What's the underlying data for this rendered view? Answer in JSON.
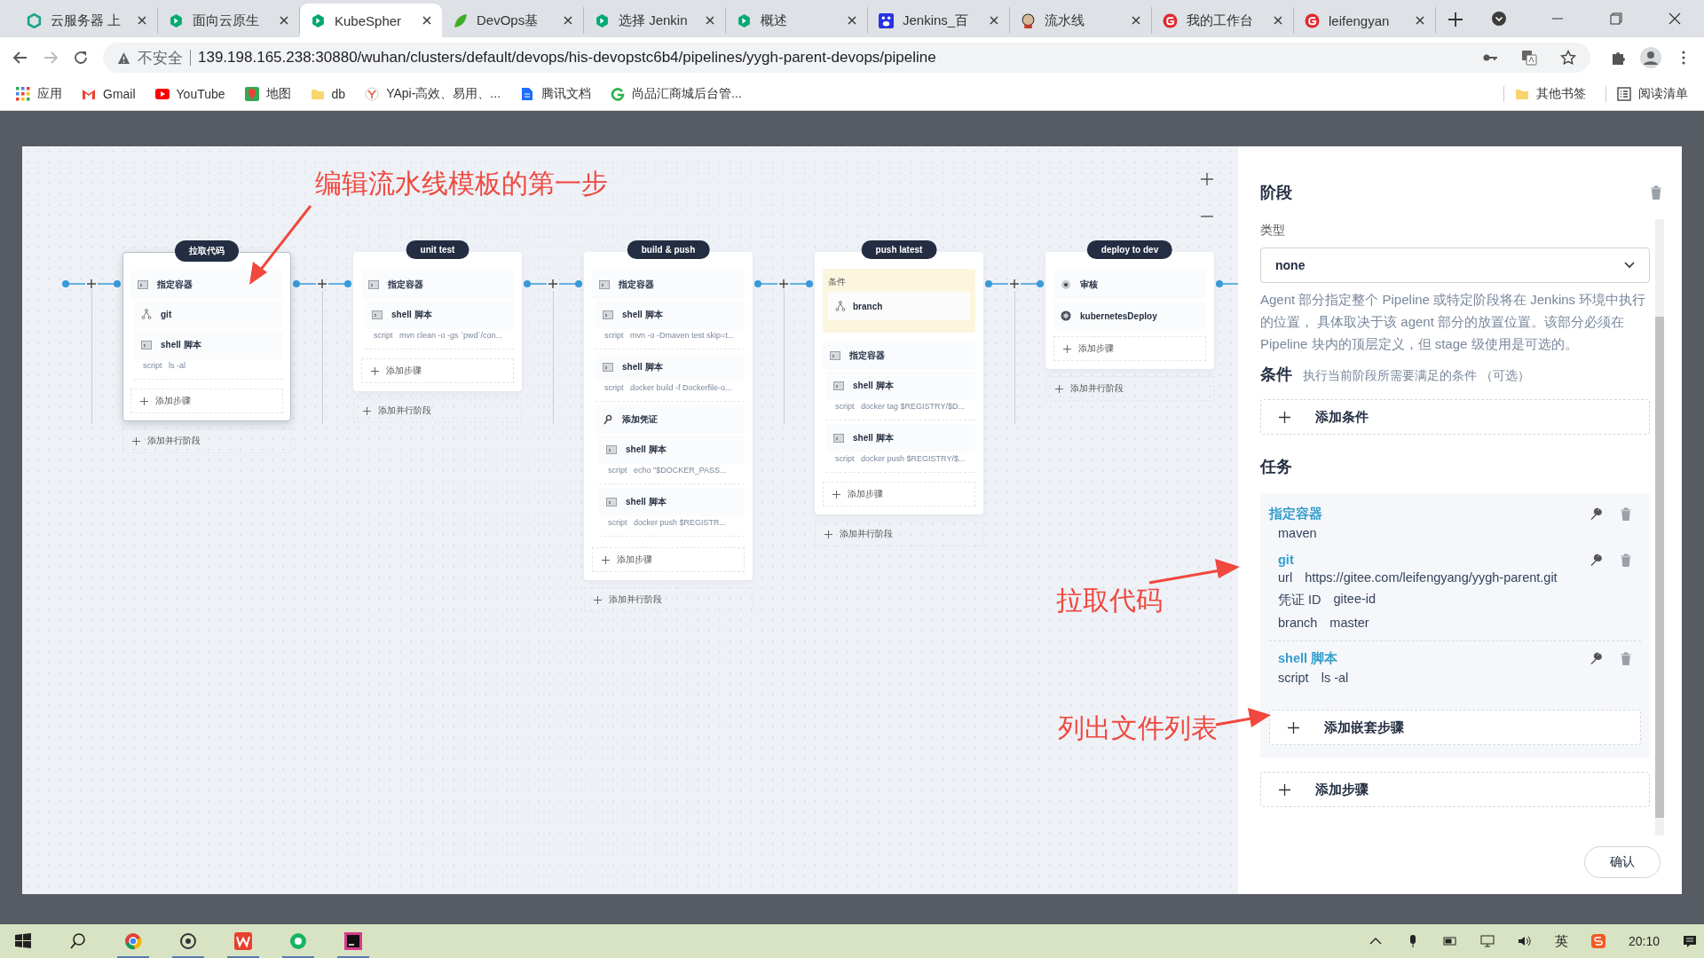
{
  "browser": {
    "tabs": [
      {
        "kind": "cloud",
        "title": "云服务器 上",
        "selected": false
      },
      {
        "kind": "kubesphere",
        "title": "面向云原生",
        "selected": false
      },
      {
        "kind": "kubesphere",
        "title": "KubeSpher",
        "selected": true
      },
      {
        "kind": "devops",
        "title": "DevOps基",
        "selected": false
      },
      {
        "kind": "kubesphere",
        "title": "选择 Jenkin",
        "selected": false
      },
      {
        "kind": "kubesphere",
        "title": "概述",
        "selected": false
      },
      {
        "kind": "baidu",
        "title": "Jenkins_百",
        "selected": false
      },
      {
        "kind": "jenkins",
        "title": "流水线",
        "selected": false
      },
      {
        "kind": "gitee",
        "title": "我的工作台",
        "selected": false
      },
      {
        "kind": "gitee",
        "title": "leifengyan",
        "selected": false
      }
    ],
    "security": "不安全",
    "url": "139.198.165.238:30880/wuhan/clusters/default/devops/his-devopstc6b4/pipelines/yygh-parent-devops/pipeline",
    "bookmarks": [
      {
        "kind": "apps",
        "label": "应用"
      },
      {
        "kind": "gmail",
        "label": "Gmail"
      },
      {
        "kind": "youtube",
        "label": "YouTube"
      },
      {
        "kind": "maps",
        "label": "地图"
      },
      {
        "kind": "folder",
        "label": "db"
      },
      {
        "kind": "yapi",
        "label": "YApi-高效、易用、..."
      },
      {
        "kind": "docs",
        "label": "腾讯文档"
      },
      {
        "kind": "g",
        "label": "尚品汇商城后台管..."
      }
    ],
    "other_bookmarks": "其他书签",
    "reading_list": "阅读清单"
  },
  "stages": [
    {
      "title": "拉取代码",
      "selected": true,
      "steps": [
        {
          "kind": "container",
          "name": "指定容器",
          "children": [
            {
              "kind": "git",
              "name": "git"
            },
            {
              "kind": "shell",
              "name": "shell 脚本",
              "detail_key": "script",
              "detail": "ls -al"
            }
          ]
        }
      ],
      "add_step": "添加步骤",
      "add_parallel": "添加并行阶段"
    },
    {
      "title": "unit test",
      "selected": false,
      "steps": [
        {
          "kind": "container",
          "name": "指定容器",
          "children": [
            {
              "kind": "shell",
              "name": "shell 脚本",
              "detail_key": "script",
              "detail": "mvn clean -o -gs `pwd`/con..."
            }
          ]
        }
      ],
      "add_step": "添加步骤",
      "add_parallel": "添加并行阶段"
    },
    {
      "title": "build & push",
      "selected": false,
      "steps": [
        {
          "kind": "container",
          "name": "指定容器",
          "children": [
            {
              "kind": "shell",
              "name": "shell 脚本",
              "detail_key": "script",
              "detail": "mvn -o -Dmaven test skip=t..."
            },
            {
              "kind": "shell",
              "name": "shell 脚本",
              "detail_key": "script",
              "detail": "docker build -f Dockerfile-o..."
            },
            {
              "kind": "credential",
              "name": "添加凭证",
              "children": [
                {
                  "kind": "shell",
                  "name": "shell 脚本",
                  "detail_key": "script",
                  "detail": "echo \"$DOCKER_PASS..."
                },
                {
                  "kind": "shell",
                  "name": "shell 脚本",
                  "detail_key": "script",
                  "detail": "docker push $REGISTR..."
                }
              ]
            }
          ]
        }
      ],
      "add_step": "添加步骤",
      "add_parallel": "添加并行阶段"
    },
    {
      "title": "push latest",
      "selected": false,
      "condition": {
        "label": "条件",
        "name": "branch"
      },
      "steps": [
        {
          "kind": "container",
          "name": "指定容器",
          "children": [
            {
              "kind": "shell",
              "name": "shell 脚本",
              "detail_key": "script",
              "detail": "docker tag $REGISTRY/$D..."
            },
            {
              "kind": "shell",
              "name": "shell 脚本",
              "detail_key": "script",
              "detail": "docker push $REGISTRY/$..."
            }
          ]
        }
      ],
      "add_step": "添加步骤",
      "add_parallel": "添加并行阶段"
    },
    {
      "title": "deploy to dev",
      "selected": false,
      "steps": [
        {
          "kind": "input",
          "name": "审核"
        },
        {
          "kind": "deploy",
          "name": "kubernetesDeploy"
        }
      ],
      "add_step": "添加步骤",
      "add_parallel": "添加并行阶段"
    }
  ],
  "panel": {
    "title": "阶段",
    "type_label": "类型",
    "type_value": "none",
    "description": "Agent 部分指定整个 Pipeline 或特定阶段将在 Jenkins 环境中执行的位置， 具体取决于该 agent 部分的放置位置。该部分必须在 Pipeline 块内的顶层定义，但 stage 级使用是可选的。",
    "conditions_title": "条件",
    "conditions_hint": "执行当前阶段所需要满足的条件 （可选）",
    "add_condition": "添加条件",
    "tasks_title": "任务",
    "tasks": [
      {
        "kind": "container",
        "name": "指定容器",
        "params": [
          {
            "value": "maven"
          }
        ],
        "children": [
          {
            "name": "git",
            "params": [
              {
                "key": "url",
                "value": "https://gitee.com/leifengyang/yygh-parent.git"
              },
              {
                "key": "凭证 ID",
                "value": "gitee-id"
              },
              {
                "key": "branch",
                "value": "master"
              }
            ]
          },
          {
            "name": "shell 脚本",
            "params": [
              {
                "key": "script",
                "value": "ls -al"
              }
            ]
          }
        ],
        "add_nested": "添加嵌套步骤"
      }
    ],
    "add_step": "添加步骤",
    "confirm": "确认"
  },
  "annotations": [
    {
      "text": "编辑流水线模板的第一步"
    },
    {
      "text": "拉取代码"
    },
    {
      "text": "列出文件列表"
    }
  ],
  "taskbar": {
    "ime": "英",
    "time": "20:10"
  }
}
